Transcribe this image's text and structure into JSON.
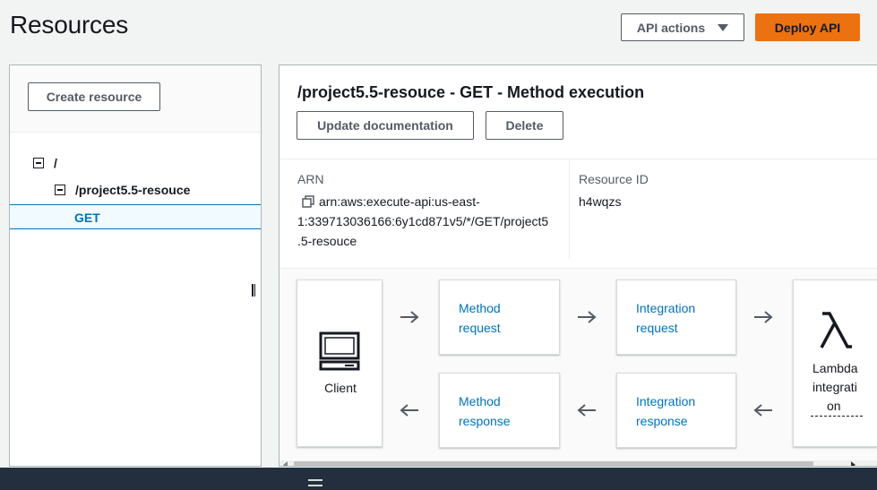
{
  "header": {
    "title": "Resources",
    "api_actions_label": "API actions",
    "deploy_label": "Deploy API"
  },
  "left_panel": {
    "create_resource_label": "Create resource",
    "tree": {
      "root_label": "/",
      "child_label": "/project5.5-resouce",
      "method_label": "GET"
    }
  },
  "method_panel": {
    "title": "/project5.5-resouce - GET - Method execution",
    "update_doc_label": "Update documentation",
    "delete_label": "Delete",
    "arn_label": "ARN",
    "arn_line1": "arn:aws:execute-api:us-east-",
    "arn_line2": "1:339713036166:6y1cd871v5/*/GET/project5",
    "arn_line3": ".5-resouce",
    "resource_id_label": "Resource ID",
    "resource_id_value": "h4wqzs"
  },
  "flow": {
    "client_label": "Client",
    "method_request": [
      "Method",
      "request"
    ],
    "integration_request": [
      "Integration",
      "request"
    ],
    "method_response": [
      "Method",
      "response"
    ],
    "integration_response": [
      "Integration",
      "response"
    ],
    "lambda_label": [
      "Lambda",
      "integrati",
      "on"
    ]
  },
  "colors": {
    "accent_orange": "#ec7211",
    "link_blue": "#0073bb",
    "footer_dark": "#232f3e"
  }
}
